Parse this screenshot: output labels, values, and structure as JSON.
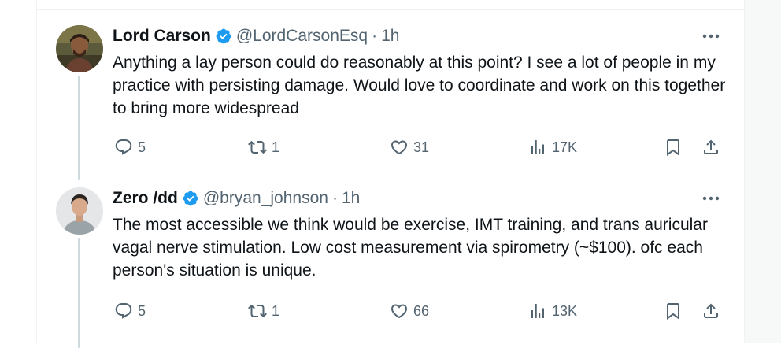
{
  "colors": {
    "text": "#0f1419",
    "muted": "#536471",
    "verified": "#1d9bf0",
    "thread_line": "#cfd9de"
  },
  "tweets": [
    {
      "author": {
        "name": "Lord Carson",
        "verified_icon": "verified-badge-icon",
        "handle": "@LordCarsonEsq",
        "separator": "·",
        "time": "1h"
      },
      "text": "Anything a lay person could do reasonably at this point? I see a lot of people in my practice with persisting damage. Would love to coordinate and work on this together to bring more widespread",
      "stats": {
        "replies": "5",
        "reposts": "1",
        "likes": "31",
        "views": "17K"
      }
    },
    {
      "author": {
        "name": "Zero /dd",
        "verified_icon": "verified-badge-icon",
        "handle": "@bryan_johnson",
        "separator": "·",
        "time": "1h"
      },
      "text": "The most accessible we think would be exercise, IMT training, and trans auricular vagal nerve stimulation. Low cost measurement via spirometry (~$100). ofc each person's situation is unique.",
      "stats": {
        "replies": "5",
        "reposts": "1",
        "likes": "66",
        "views": "13K"
      }
    }
  ]
}
